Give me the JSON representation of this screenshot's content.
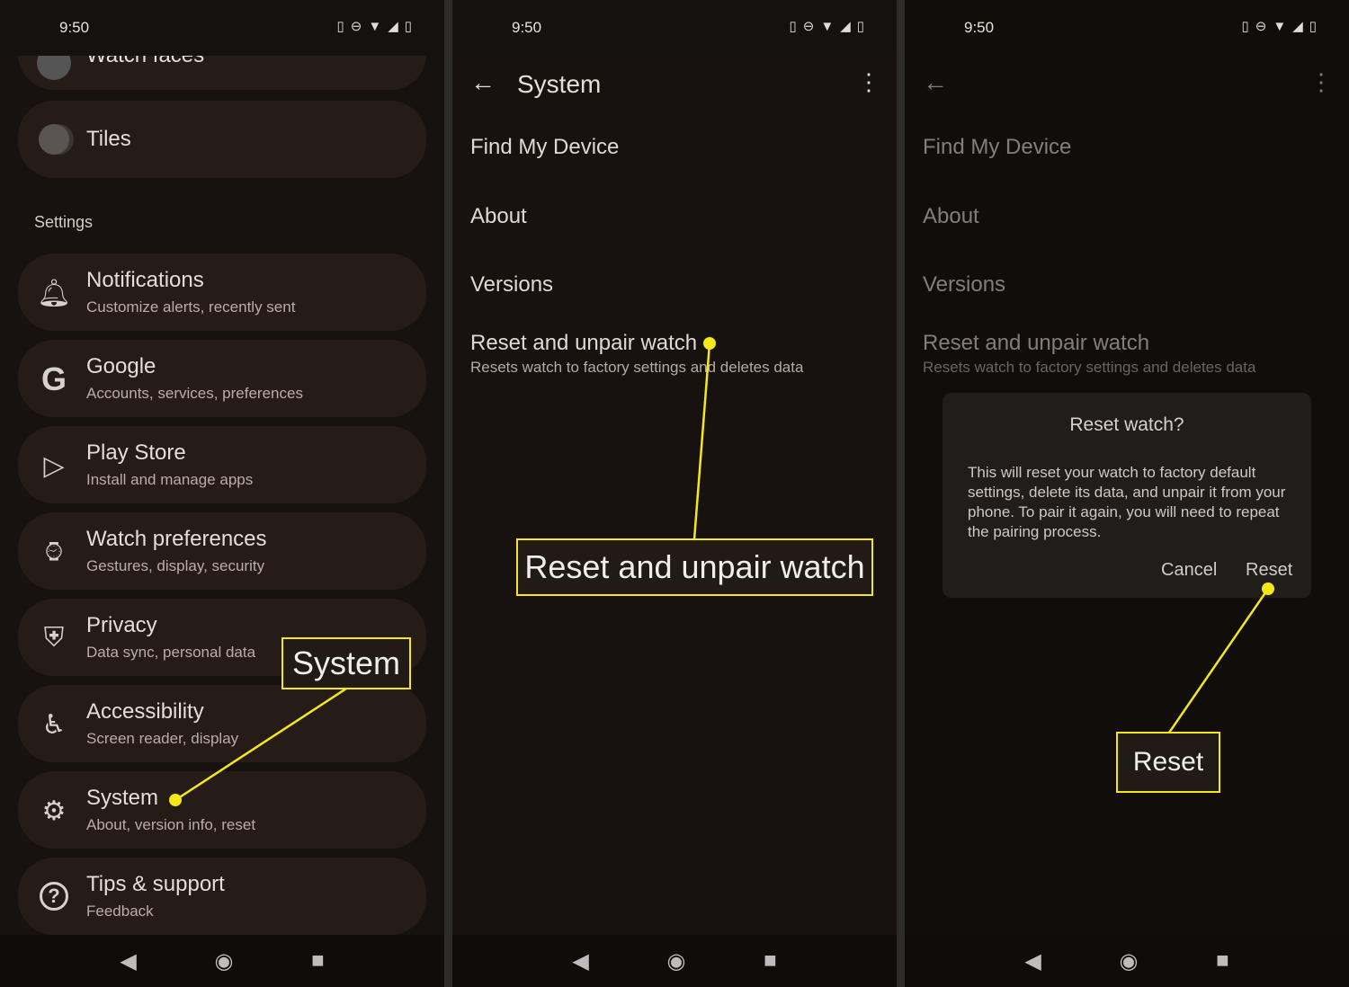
{
  "status": {
    "time": "9:50",
    "icons": [
      "vibrate-icon",
      "dnd-icon",
      "wifi-icon",
      "signal-icon",
      "battery-icon"
    ]
  },
  "panel1": {
    "partial_item": "Watch faces",
    "tiles": "Tiles",
    "section": "Settings",
    "items": [
      {
        "icon": "bell-icon",
        "title": "Notifications",
        "subtitle": "Customize alerts, recently sent"
      },
      {
        "icon": "google-icon",
        "title": "Google",
        "subtitle": "Accounts, services, preferences"
      },
      {
        "icon": "play-store-icon",
        "title": "Play Store",
        "subtitle": "Install and manage apps"
      },
      {
        "icon": "watch-icon",
        "title": "Watch preferences",
        "subtitle": "Gestures, display, security"
      },
      {
        "icon": "shield-icon",
        "title": "Privacy",
        "subtitle": "Data sync, personal data"
      },
      {
        "icon": "accessibility-icon",
        "title": "Accessibility",
        "subtitle": "Screen reader, display"
      },
      {
        "icon": "gear-icon",
        "title": "System",
        "subtitle": "About, version info, reset"
      },
      {
        "icon": "help-icon",
        "title": "Tips & support",
        "subtitle": "Feedback"
      }
    ],
    "callout": "System"
  },
  "panel2": {
    "title": "System",
    "items": [
      "Find My Device",
      "About",
      "Versions"
    ],
    "reset_title": "Reset and unpair watch",
    "reset_sub": "Resets watch to factory settings and deletes data",
    "callout": "Reset and unpair watch"
  },
  "panel3": {
    "items": [
      "Find My Device",
      "About",
      "Versions"
    ],
    "reset_title": "Reset and unpair watch",
    "reset_sub": "Resets watch to factory settings and deletes data",
    "dialog": {
      "title": "Reset watch?",
      "body": "This will reset your watch to factory default settings, delete its data, and unpair it from your phone. To pair it again, you will need to repeat the pairing process.",
      "cancel": "Cancel",
      "confirm": "Reset"
    },
    "callout": "Reset"
  },
  "colors": {
    "callout": "#f4e71a",
    "card": "#251c17",
    "background": "#17120f"
  }
}
